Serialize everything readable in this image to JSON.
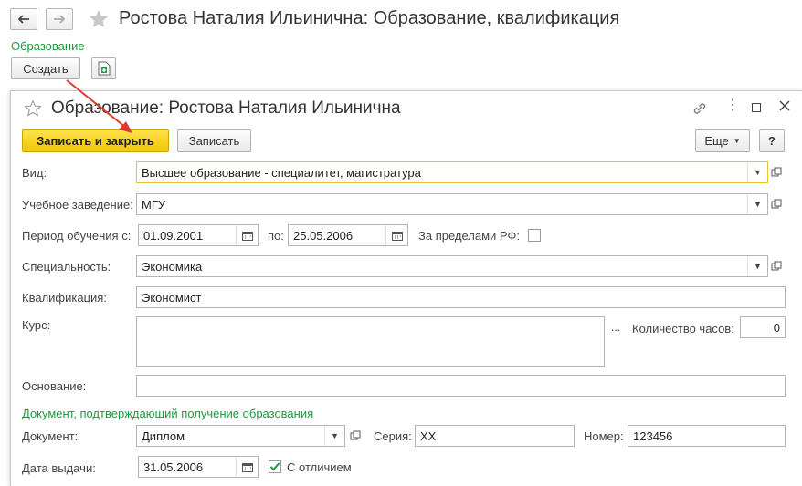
{
  "window": {
    "title": "Ростова Наталия Ильинична: Образование, квалификация",
    "section_link": "Образование",
    "create_label": "Создать"
  },
  "dialog": {
    "title": "Образование: Ростова Наталия Ильинична",
    "save_close_label": "Записать и закрыть",
    "save_label": "Записать",
    "more_label": "Еще",
    "help_label": "?"
  },
  "form": {
    "type_label": "Вид:",
    "type_value": "Высшее образование - специалитет, магистратура",
    "institution_label": "Учебное заведение:",
    "institution_value": "МГУ",
    "period_label": "Период обучения с:",
    "period_from": "01.09.2001",
    "period_to_label": "по:",
    "period_to": "25.05.2006",
    "abroad_label": "За пределами РФ:",
    "specialty_label": "Специальность:",
    "specialty_value": "Экономика",
    "qualification_label": "Квалификация:",
    "qualification_value": "Экономист",
    "course_label": "Курс:",
    "course_value": "",
    "course_select": "...",
    "hours_label": "Количество часов:",
    "hours_value": "0",
    "basis_label": "Основание:",
    "basis_value": ""
  },
  "document_section": {
    "title": "Документ, подтверждающий получение образования",
    "doc_label": "Документ:",
    "doc_value": "Диплом",
    "series_label": "Серия:",
    "series_value": "ХХ",
    "number_label": "Номер:",
    "number_value": "123456",
    "issue_label": "Дата выдачи:",
    "issue_value": "31.05.2006",
    "honors_label": "С отличием",
    "honors_checked": true
  },
  "colors": {
    "accent_green": "#1e9b3c",
    "primary_yellow": "#f5cf1a",
    "annotation_red": "#e03a2f"
  }
}
